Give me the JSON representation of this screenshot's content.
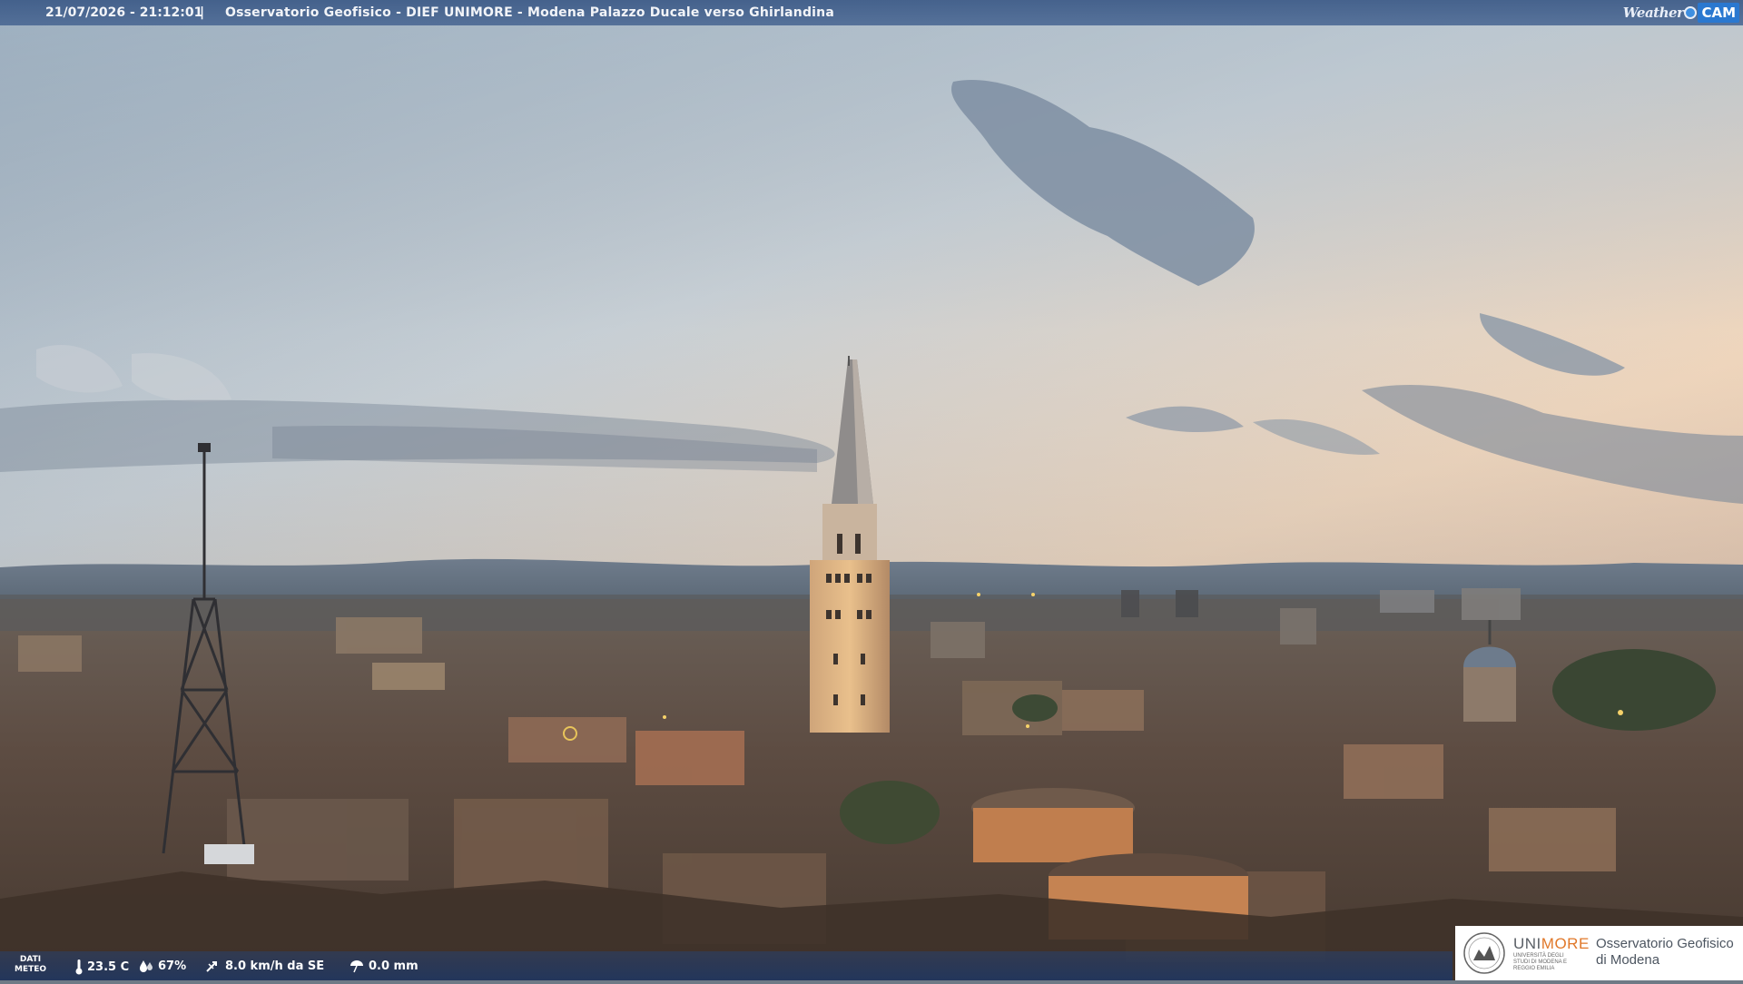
{
  "header": {
    "datetime": "21/07/2026 - 21:12:01",
    "separator": "|",
    "title": "Osservatorio Geofisico - DIEF UNIMORE - Modena Palazzo Ducale verso Ghirlandina",
    "logo_weather": "Weather",
    "logo_cam": "CAM"
  },
  "weather": {
    "label_line1": "DATI",
    "label_line2": "METEO",
    "temperature": "23.5 C",
    "humidity": "67%",
    "wind": "8.0 km/h da SE",
    "rain": "0.0 mm"
  },
  "footer_logo": {
    "uni": "UNI",
    "more": "MORE",
    "uni_sub": "UNIVERSITÀ DEGLI STUDI DI MODENA E REGGIO EMILIA",
    "obs_line1": "Osservatorio Geofisico",
    "obs_line2": "di Modena"
  },
  "colors": {
    "sky_top": "#9fb2c4",
    "sky_glow": "#f1d2b4",
    "city": "#5e4c40",
    "tower_lit": "#e2b886"
  }
}
